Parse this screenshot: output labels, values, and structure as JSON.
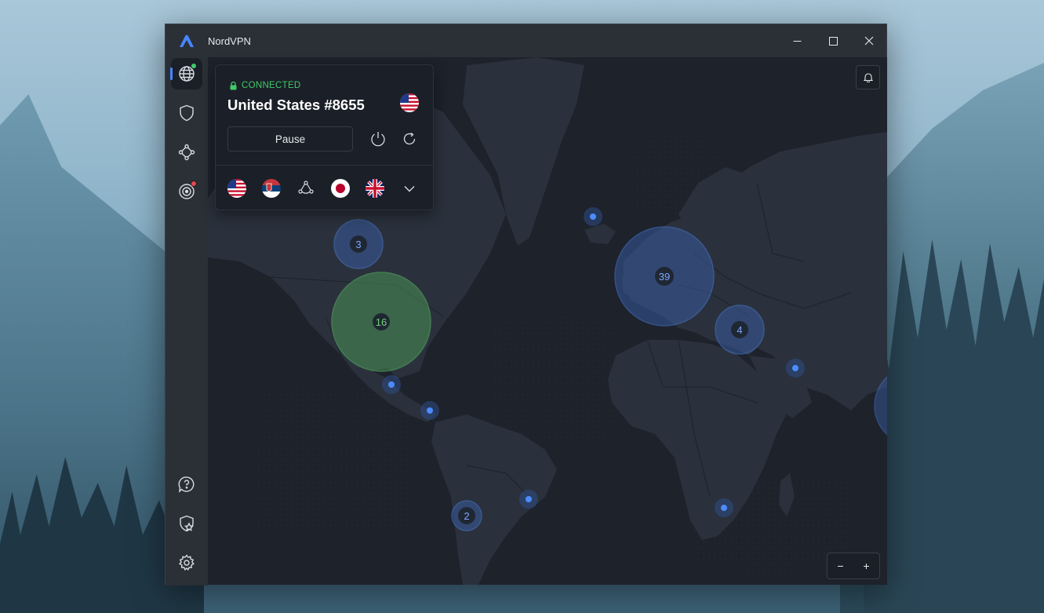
{
  "app": {
    "title": "NordVPN",
    "accent_color": "#4687ff",
    "connected_color": "#3fcb6a"
  },
  "titlebar": {
    "minimize_icon": "minimize-icon",
    "maximize_icon": "maximize-icon",
    "close_icon": "close-icon"
  },
  "sidebar": {
    "items": [
      {
        "name": "globe-icon",
        "active": true,
        "badge_color": "#3fcb6a"
      },
      {
        "name": "shield-icon",
        "active": false
      },
      {
        "name": "meshnet-icon",
        "active": false
      },
      {
        "name": "target-icon",
        "active": false,
        "badge_color": "#e5484d"
      },
      {
        "name": "help-icon",
        "active": false
      },
      {
        "name": "star-shield-icon",
        "active": false
      },
      {
        "name": "settings-icon",
        "active": false
      }
    ]
  },
  "connection": {
    "status": "CONNECTED",
    "server": "United States #8655",
    "pause_label": "Pause",
    "power_icon": "power-icon",
    "refresh_icon": "refresh-icon",
    "recent": [
      "us-flag",
      "serbia-flag",
      "meshnet-icon",
      "japan-flag",
      "uk-flag",
      "chevron-down-icon"
    ]
  },
  "map": {
    "clusters": [
      {
        "label": "3",
        "color": "blue"
      },
      {
        "label": "16",
        "color": "green"
      },
      {
        "label": "39",
        "color": "blue"
      },
      {
        "label": "4",
        "color": "blue"
      },
      {
        "label": "2",
        "color": "blue"
      }
    ]
  },
  "zoom": {
    "minus": "−",
    "plus": "+"
  }
}
